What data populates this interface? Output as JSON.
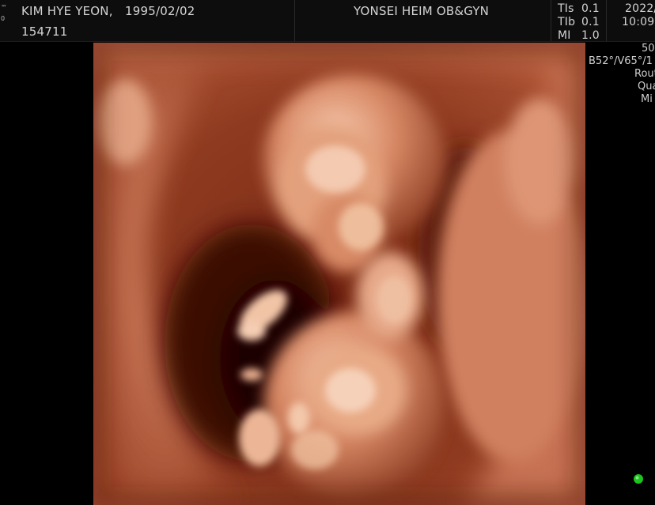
{
  "header": {
    "corner_mark_top": "™",
    "corner_mark_bottom": "0",
    "patient_name": "KIM HYE YEON,",
    "birth_date": "1995/02/02",
    "patient_id": "154711",
    "institution": "YONSEI HEIM OB&GYN",
    "metrics": [
      {
        "label": "TIs",
        "value": "0.1"
      },
      {
        "label": "TIb",
        "value": "0.1"
      },
      {
        "label": "MI",
        "value": "1.0"
      }
    ],
    "date_partial": "2022/",
    "time_partial": "10:09:"
  },
  "side_params": [
    "50",
    "B52°/V65°/1",
    "Rout",
    "Qua",
    "Mi"
  ],
  "colors": {
    "background": "#000000",
    "header_bg": "#0d0d0d",
    "header_text": "#d4d4d4",
    "tissue_dark": "#5a1a0c",
    "tissue_mid": "#b9563a",
    "tissue_light": "#f2c3a6",
    "status_green": "#1ec21e"
  },
  "icons": {
    "status": "green-dot-icon"
  }
}
